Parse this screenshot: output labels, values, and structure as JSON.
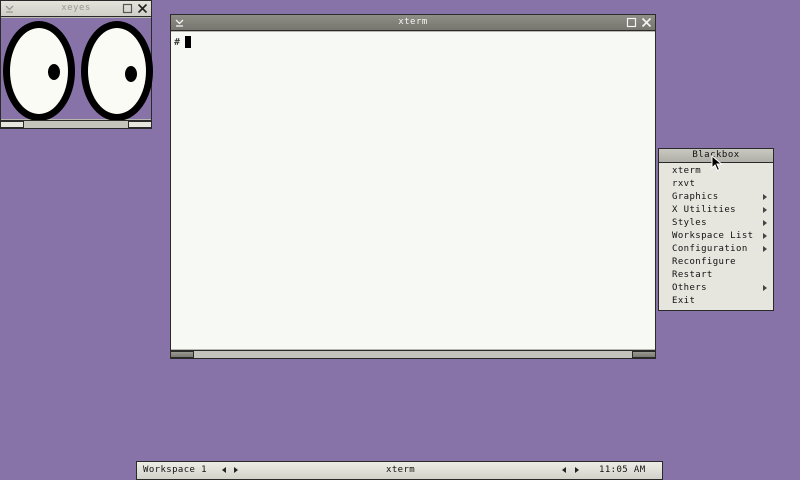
{
  "colors": {
    "desktop": "#8873a8",
    "titlebar_focused": "#76766e",
    "titlebar_unfocused": "#d8d8d0",
    "terminal_bg": "#f6f9f4",
    "menu_bg": "#e6e6de"
  },
  "xeyes": {
    "title": "xeyes"
  },
  "xterm": {
    "title": "xterm",
    "prompt": "#"
  },
  "root_menu": {
    "title": "Blackbox",
    "items": [
      {
        "label": "xterm",
        "submenu": false
      },
      {
        "label": "rxvt",
        "submenu": false
      },
      {
        "label": "Graphics",
        "submenu": true
      },
      {
        "label": "X Utilities",
        "submenu": true
      },
      {
        "label": "Styles",
        "submenu": true
      },
      {
        "label": "Workspace List",
        "submenu": true
      },
      {
        "label": "Configuration",
        "submenu": true
      },
      {
        "label": "Reconfigure",
        "submenu": false
      },
      {
        "label": "Restart",
        "submenu": false
      },
      {
        "label": "Others",
        "submenu": true
      },
      {
        "label": "Exit",
        "submenu": false
      }
    ]
  },
  "toolbar": {
    "workspace": "Workspace 1",
    "window": "xterm",
    "clock": "11:05 AM"
  },
  "icons": {
    "iconify": "minimize-icon",
    "maximize": "maximize-icon",
    "close": "close-icon",
    "submenu": "submenu-arrow-icon",
    "pointer": "mouse-pointer-icon"
  }
}
